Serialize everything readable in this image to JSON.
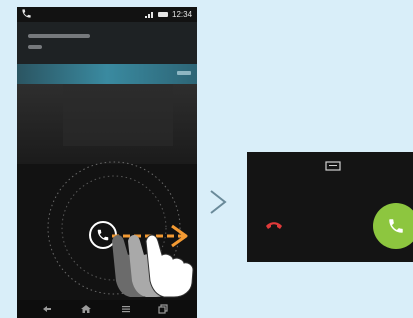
{
  "status_bar": {
    "time": "12:34"
  },
  "colors": {
    "background": "#d9eef9",
    "accent_arrow": "#f39a33",
    "answer_green": "#8dc63f",
    "decline_red": "#e03a3a",
    "teal_bar": "#3a8aa0"
  },
  "icons": {
    "status_call": "phone-icon",
    "swipe_handle": "phone-icon",
    "gesture": "finger-swipe-icon",
    "transition": "chevron-right-icon",
    "message": "message-icon",
    "decline": "phone-hangup-icon",
    "answer": "phone-icon"
  }
}
